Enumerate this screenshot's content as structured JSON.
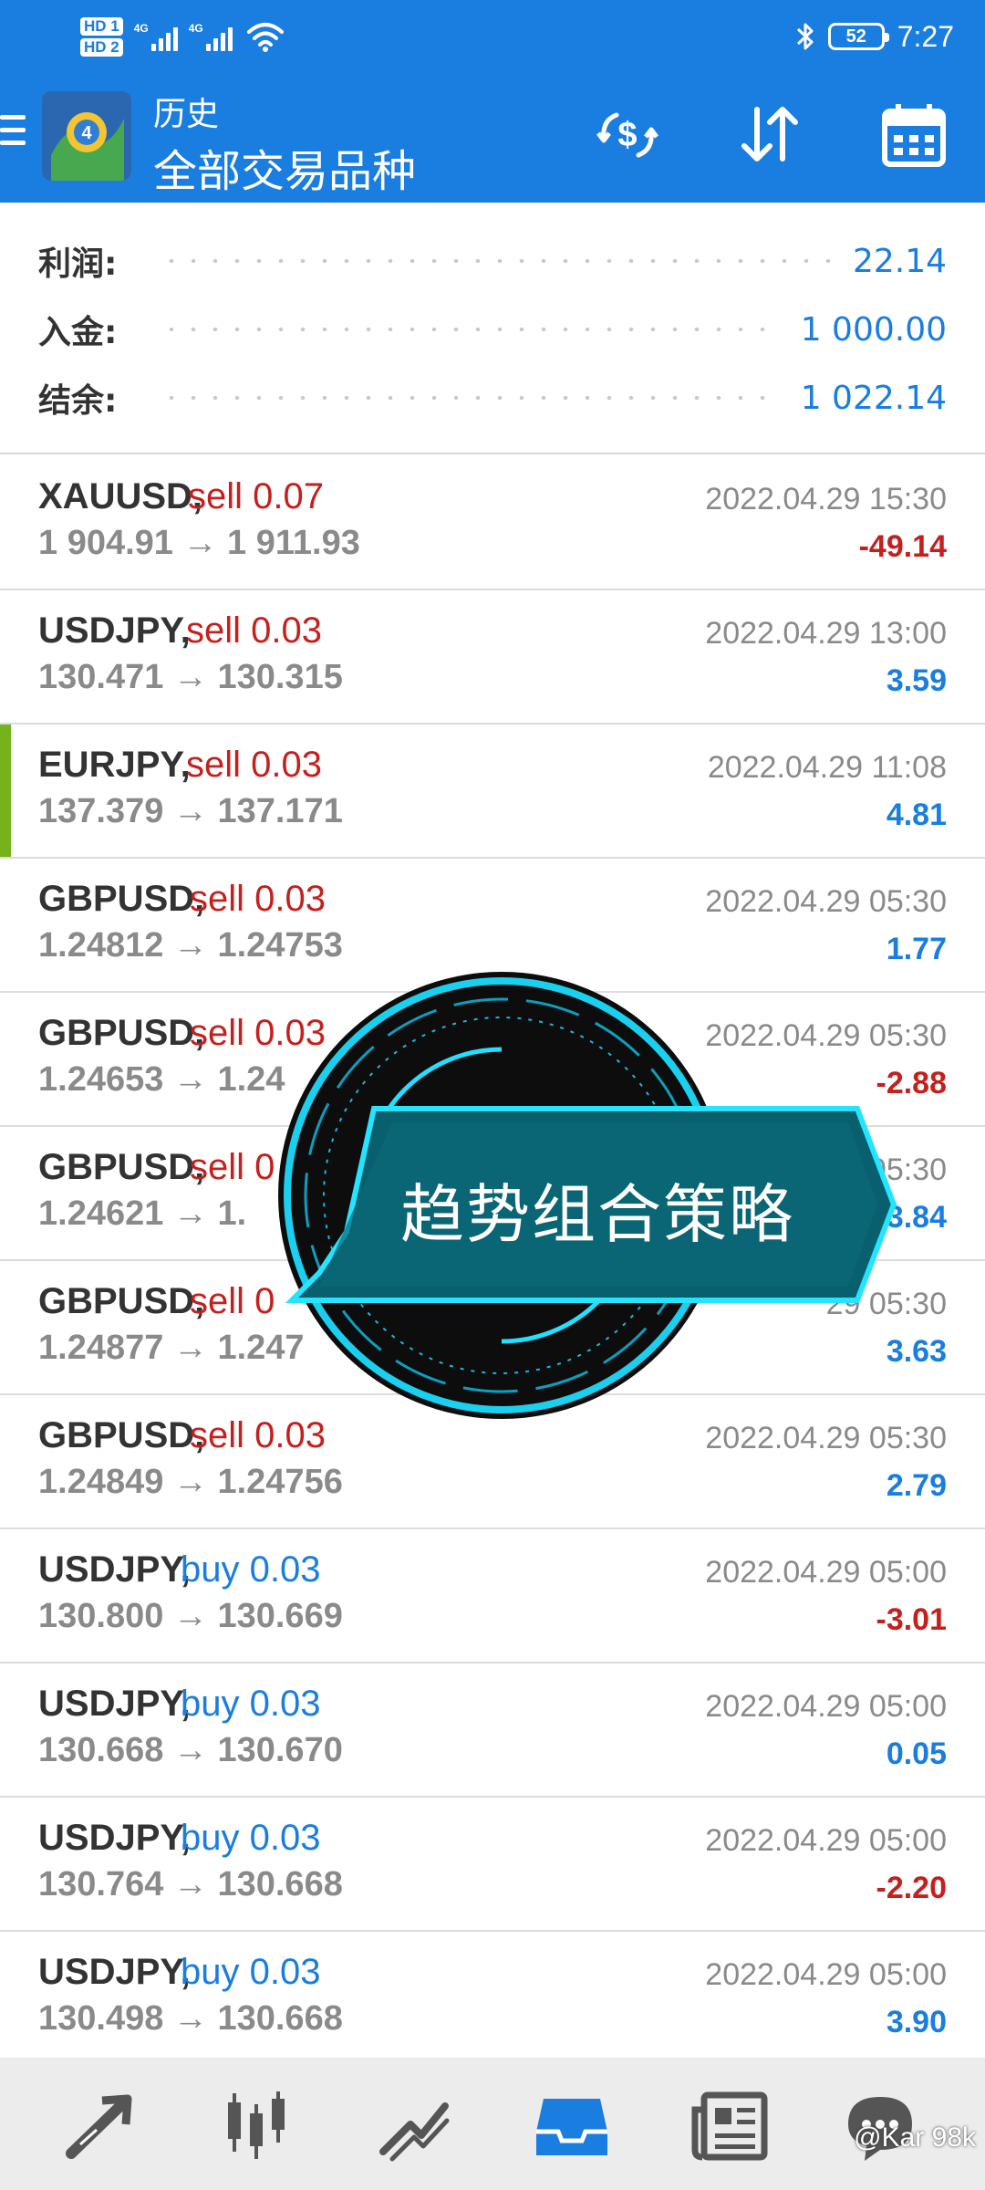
{
  "status_bar": {
    "hd1": "HD 1",
    "hd2": "HD 2",
    "net1": "4G",
    "net2": "4G",
    "battery": "52",
    "time": "7:27"
  },
  "header": {
    "title_small": "历史",
    "title_large": "全部交易品种"
  },
  "summary": {
    "profit_label": "利润:",
    "profit_value": "22.14",
    "deposit_label": "入金:",
    "deposit_value": "1 000.00",
    "balance_label": "结余:",
    "balance_value": "1 022.14"
  },
  "trades": [
    {
      "symbol": "XAUUSD,",
      "side": "sell 0.07",
      "prices": "1 904.91 → 1 911.93",
      "time": "2022.04.29 15:30",
      "profit": "-49.14"
    },
    {
      "symbol": "USDJPY,",
      "side": "sell 0.03",
      "prices": "130.471 → 130.315",
      "time": "2022.04.29 13:00",
      "profit": "3.59"
    },
    {
      "symbol": "EURJPY,",
      "side": "sell 0.03",
      "prices": "137.379 → 137.171",
      "time": "2022.04.29 11:08",
      "profit": "4.81"
    },
    {
      "symbol": "GBPUSD,",
      "side": "sell 0.03",
      "prices": "1.24812 → 1.24753",
      "time": "2022.04.29 05:30",
      "profit": "1.77"
    },
    {
      "symbol": "GBPUSD,",
      "side": "sell 0.03",
      "prices": "1.24653 → 1.24",
      "time": "2022.04.29 05:30",
      "profit": "-2.88"
    },
    {
      "symbol": "GBPUSD,",
      "side": "sell 0",
      "prices": "1.24621 → 1.",
      "time": "05:30",
      "profit": "3.84"
    },
    {
      "symbol": "GBPUSD,",
      "side": "sell 0",
      "prices": "1.24877 → 1.247",
      "time": "29 05:30",
      "profit": "3.63"
    },
    {
      "symbol": "GBPUSD,",
      "side": "sell 0.03",
      "prices": "1.24849 → 1.24756",
      "time": "2022.04.29 05:30",
      "profit": "2.79"
    },
    {
      "symbol": "USDJPY,",
      "side": "buy 0.03",
      "prices": "130.800 → 130.669",
      "time": "2022.04.29 05:00",
      "profit": "-3.01"
    },
    {
      "symbol": "USDJPY,",
      "side": "buy 0.03",
      "prices": "130.668 → 130.670",
      "time": "2022.04.29 05:00",
      "profit": "0.05"
    },
    {
      "symbol": "USDJPY,",
      "side": "buy 0.03",
      "prices": "130.764 → 130.668",
      "time": "2022.04.29 05:00",
      "profit": "-2.20"
    },
    {
      "symbol": "USDJPY,",
      "side": "buy 0.03",
      "prices": "130.498 → 130.668",
      "time": "2022.04.29 05:00",
      "profit": "3.90"
    }
  ],
  "overlay": {
    "text": "趋势组合策略"
  },
  "watermark": "@Kar 98k",
  "colors": {
    "header_bg": "#1a7de0",
    "sell": "#c5201d",
    "buy": "#1a7de0",
    "selected_marker": "#74b31c"
  },
  "icons": [
    "menu-icon",
    "exchange-dollar-icon",
    "sort-icon",
    "calendar-icon",
    "trade-arrow-icon",
    "candles-icon",
    "chart-line-icon",
    "inbox-icon",
    "news-icon",
    "chat-icon"
  ]
}
